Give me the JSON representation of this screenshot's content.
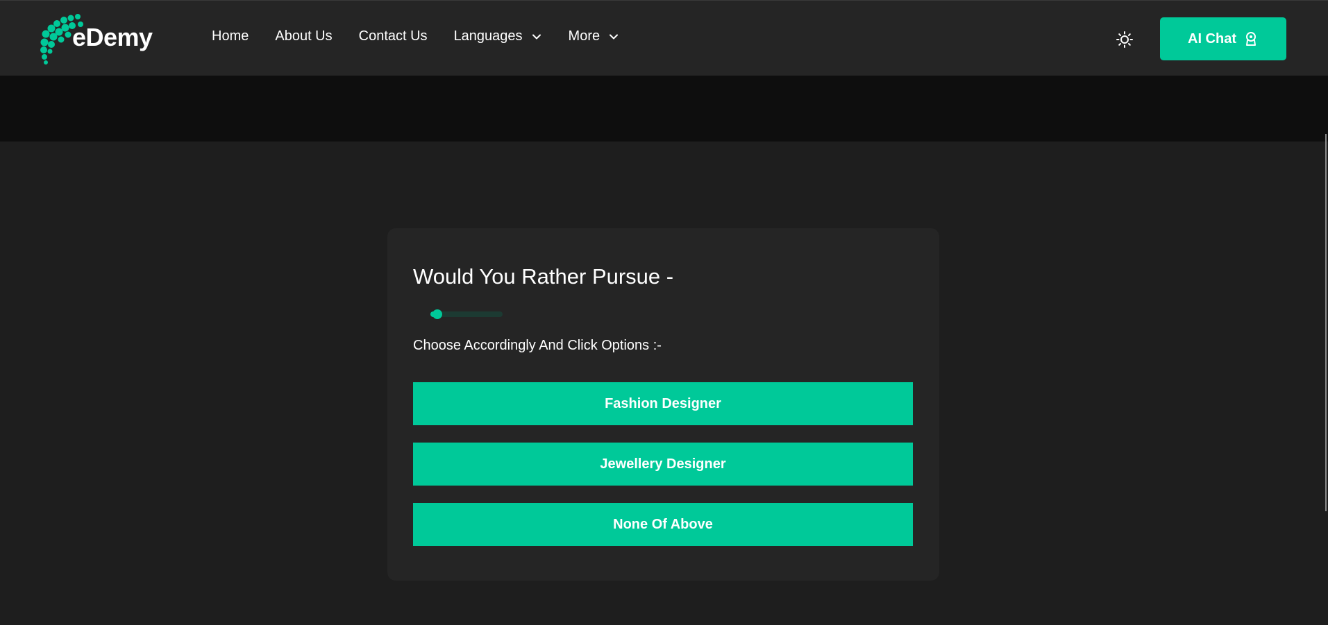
{
  "brand": {
    "name": "eDemy",
    "accent_color": "#00c999"
  },
  "nav": {
    "items": [
      {
        "label": "Home"
      },
      {
        "label": "About Us"
      },
      {
        "label": "Contact Us"
      },
      {
        "label": "Languages",
        "icon": "chevron-down-icon"
      },
      {
        "label": "More",
        "icon": "chevron-down-icon"
      }
    ]
  },
  "header": {
    "theme_toggle_icon": "sun-icon",
    "ai_chat_label": "AI Chat",
    "ai_chat_icon": "bot-icon"
  },
  "quiz": {
    "question": "Would You Rather Pursue -",
    "progress": 0.1,
    "instruction": "Choose Accordingly And Click Options :-",
    "options": [
      {
        "label": "Fashion Designer"
      },
      {
        "label": "Jewellery Designer"
      },
      {
        "label": "None Of Above"
      }
    ]
  }
}
